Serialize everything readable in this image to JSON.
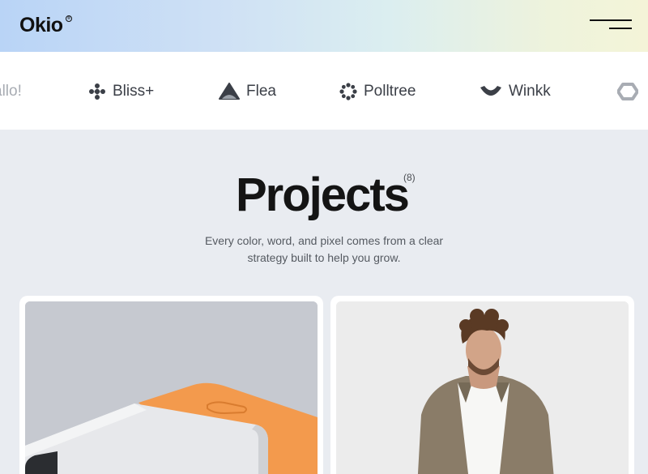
{
  "header": {
    "logo_text": "Okio",
    "logo_mark": "®",
    "menu_icon": "hamburger-menu-icon"
  },
  "brands": [
    {
      "name": "allo!",
      "icon": "none",
      "faded": true
    },
    {
      "name": "Bliss+",
      "icon": "bliss-logo-icon"
    },
    {
      "name": "Flea",
      "icon": "flea-logo-icon"
    },
    {
      "name": "Polltree",
      "icon": "polltree-logo-icon"
    },
    {
      "name": "Winkk",
      "icon": "winkk-logo-icon"
    },
    {
      "name": "",
      "icon": "hexagon-logo-icon",
      "faded": true
    }
  ],
  "projects": {
    "title": "Projects",
    "count": "(8)",
    "subtitle": "Every color, word, and pixel comes from a clear strategy built to help you grow."
  },
  "cards": [
    {
      "image": "orange-grey-speaker-device-photo"
    },
    {
      "image": "man-in-olive-shirt-photo"
    }
  ],
  "colors": {
    "background": "#e9ecf1",
    "text": "#141414",
    "brand_text": "#3b3f47",
    "device_orange": "#f39a4d"
  }
}
